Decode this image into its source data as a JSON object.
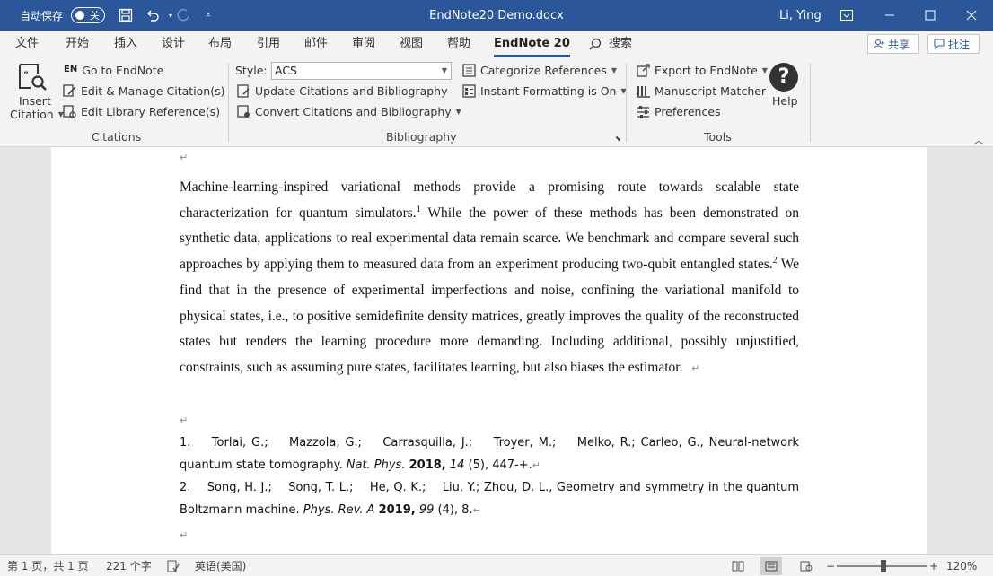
{
  "titlebar": {
    "autosave_label": "自动保存",
    "autosave_state": "关",
    "document_title": "EndNote20 Demo.docx",
    "user_name": "Li, Ying"
  },
  "tabs": [
    "文件",
    "开始",
    "插入",
    "设计",
    "布局",
    "引用",
    "邮件",
    "审阅",
    "视图",
    "帮助",
    "EndNote 20",
    "搜索"
  ],
  "active_tab": "EndNote 20",
  "share_label": "共享",
  "comment_label": "批注",
  "ribbon": {
    "insert_label_1": "Insert",
    "insert_label_2": "Citation",
    "goto_en_icon": "EN",
    "goto": "Go to EndNote",
    "edit_manage": "Edit & Manage Citation(s)",
    "edit_library": "Edit Library Reference(s)",
    "citations_group": "Citations",
    "style_label": "Style:",
    "style_value": "ACS",
    "update": "Update Citations and Bibliography",
    "convert": "Convert Citations and Bibliography",
    "categorize": "Categorize References",
    "instant": "Instant Formatting is On",
    "bibliography_group": "Bibliography",
    "export": "Export to EndNote",
    "manuscript": "Manuscript Matcher",
    "preferences": "Preferences",
    "help": "Help",
    "tools_group": "Tools"
  },
  "document": {
    "para_mark": "↵",
    "body_parts": [
      "Machine-learning-inspired variational methods provide a promising route towards scalable state characterization for quantum simulators.",
      "1",
      " While the power of these methods has been demonstrated on synthetic data, applications to real experimental data remain scarce. We benchmark and compare several such approaches by applying them to measured data from an experiment producing two-qubit entangled states.",
      "2",
      " We find that in the presence of experimental imperfections and noise, confining the variational manifold to physical states, i.e., to positive semidefinite density matrices, greatly improves the quality of the reconstructed states but renders the learning procedure more demanding. Including additional, possibly unjustified, constraints, such as assuming pure states, facilitates learning, but also biases the estimator. "
    ],
    "refs": [
      {
        "authors": "1.    Torlai, G.;    Mazzola, G.;    Carrasquilla, J.;    Troyer, M.;    Melko, R.; Carleo, G., Neural-network quantum state tomography. ",
        "journal": "Nat. Phys.",
        "year": "2018,",
        "volume": "14",
        "rest": " (5), 447-+."
      },
      {
        "authors": "2.    Song, H. J.;    Song, T. L.;    He, Q. K.;    Liu, Y.; Zhou, D. L., Geometry and symmetry in the quantum Boltzmann machine. ",
        "journal": "Phys. Rev. A",
        "year": "2019,",
        "volume": "99",
        "rest": " (4), 8."
      }
    ]
  },
  "status": {
    "page": "第 1 页，共 1 页",
    "words": "221 个字",
    "language": "英语(美国)",
    "zoom": "120%",
    "zoom_minus": "−",
    "zoom_plus": "+"
  },
  "colors": {
    "titlebar": "#2b579a",
    "ribbon": "#f3f3f3",
    "canvas": "#e6e6e6"
  }
}
